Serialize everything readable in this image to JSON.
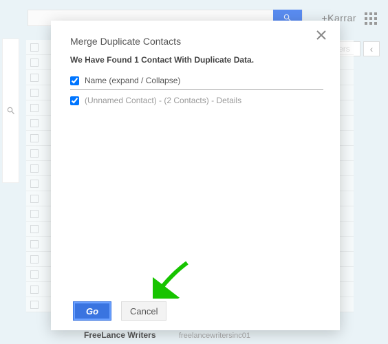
{
  "background": {
    "username": "+Karrar",
    "right_pill": "Writers",
    "bottom_name": "FreeLance Writers",
    "bottom_email": "freelancewritersinc01"
  },
  "modal": {
    "title": "Merge Duplicate Contacts",
    "subtitle": "We Have Found 1 Contact With Duplicate Data.",
    "header_checkbox_label": "Name (expand / Collapse)",
    "contact_row_label": "(Unnamed Contact) - (2 Contacts) - Details",
    "go_label": "Go",
    "cancel_label": "Cancel"
  }
}
